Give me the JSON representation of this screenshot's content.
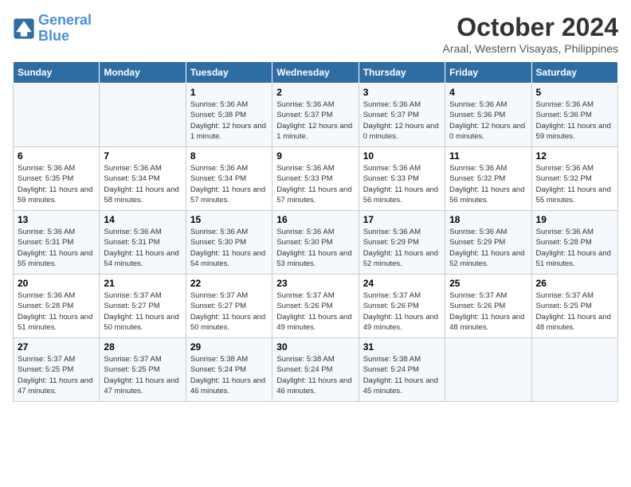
{
  "logo": {
    "line1": "General",
    "line2": "Blue"
  },
  "title": "October 2024",
  "subtitle": "Araal, Western Visayas, Philippines",
  "weekdays": [
    "Sunday",
    "Monday",
    "Tuesday",
    "Wednesday",
    "Thursday",
    "Friday",
    "Saturday"
  ],
  "weeks": [
    [
      {
        "day": "",
        "info": ""
      },
      {
        "day": "",
        "info": ""
      },
      {
        "day": "1",
        "info": "Sunrise: 5:36 AM\nSunset: 5:38 PM\nDaylight: 12 hours\nand 1 minute."
      },
      {
        "day": "2",
        "info": "Sunrise: 5:36 AM\nSunset: 5:37 PM\nDaylight: 12 hours\nand 1 minute."
      },
      {
        "day": "3",
        "info": "Sunrise: 5:36 AM\nSunset: 5:37 PM\nDaylight: 12 hours\nand 0 minutes."
      },
      {
        "day": "4",
        "info": "Sunrise: 5:36 AM\nSunset: 5:36 PM\nDaylight: 12 hours\nand 0 minutes."
      },
      {
        "day": "5",
        "info": "Sunrise: 5:36 AM\nSunset: 5:36 PM\nDaylight: 11 hours\nand 59 minutes."
      }
    ],
    [
      {
        "day": "6",
        "info": "Sunrise: 5:36 AM\nSunset: 5:35 PM\nDaylight: 11 hours\nand 59 minutes."
      },
      {
        "day": "7",
        "info": "Sunrise: 5:36 AM\nSunset: 5:34 PM\nDaylight: 11 hours\nand 58 minutes."
      },
      {
        "day": "8",
        "info": "Sunrise: 5:36 AM\nSunset: 5:34 PM\nDaylight: 11 hours\nand 57 minutes."
      },
      {
        "day": "9",
        "info": "Sunrise: 5:36 AM\nSunset: 5:33 PM\nDaylight: 11 hours\nand 57 minutes."
      },
      {
        "day": "10",
        "info": "Sunrise: 5:36 AM\nSunset: 5:33 PM\nDaylight: 11 hours\nand 56 minutes."
      },
      {
        "day": "11",
        "info": "Sunrise: 5:36 AM\nSunset: 5:32 PM\nDaylight: 11 hours\nand 56 minutes."
      },
      {
        "day": "12",
        "info": "Sunrise: 5:36 AM\nSunset: 5:32 PM\nDaylight: 11 hours\nand 55 minutes."
      }
    ],
    [
      {
        "day": "13",
        "info": "Sunrise: 5:36 AM\nSunset: 5:31 PM\nDaylight: 11 hours\nand 55 minutes."
      },
      {
        "day": "14",
        "info": "Sunrise: 5:36 AM\nSunset: 5:31 PM\nDaylight: 11 hours\nand 54 minutes."
      },
      {
        "day": "15",
        "info": "Sunrise: 5:36 AM\nSunset: 5:30 PM\nDaylight: 11 hours\nand 54 minutes."
      },
      {
        "day": "16",
        "info": "Sunrise: 5:36 AM\nSunset: 5:30 PM\nDaylight: 11 hours\nand 53 minutes."
      },
      {
        "day": "17",
        "info": "Sunrise: 5:36 AM\nSunset: 5:29 PM\nDaylight: 11 hours\nand 52 minutes."
      },
      {
        "day": "18",
        "info": "Sunrise: 5:36 AM\nSunset: 5:29 PM\nDaylight: 11 hours\nand 52 minutes."
      },
      {
        "day": "19",
        "info": "Sunrise: 5:36 AM\nSunset: 5:28 PM\nDaylight: 11 hours\nand 51 minutes."
      }
    ],
    [
      {
        "day": "20",
        "info": "Sunrise: 5:36 AM\nSunset: 5:28 PM\nDaylight: 11 hours\nand 51 minutes."
      },
      {
        "day": "21",
        "info": "Sunrise: 5:37 AM\nSunset: 5:27 PM\nDaylight: 11 hours\nand 50 minutes."
      },
      {
        "day": "22",
        "info": "Sunrise: 5:37 AM\nSunset: 5:27 PM\nDaylight: 11 hours\nand 50 minutes."
      },
      {
        "day": "23",
        "info": "Sunrise: 5:37 AM\nSunset: 5:26 PM\nDaylight: 11 hours\nand 49 minutes."
      },
      {
        "day": "24",
        "info": "Sunrise: 5:37 AM\nSunset: 5:26 PM\nDaylight: 11 hours\nand 49 minutes."
      },
      {
        "day": "25",
        "info": "Sunrise: 5:37 AM\nSunset: 5:26 PM\nDaylight: 11 hours\nand 48 minutes."
      },
      {
        "day": "26",
        "info": "Sunrise: 5:37 AM\nSunset: 5:25 PM\nDaylight: 11 hours\nand 48 minutes."
      }
    ],
    [
      {
        "day": "27",
        "info": "Sunrise: 5:37 AM\nSunset: 5:25 PM\nDaylight: 11 hours\nand 47 minutes."
      },
      {
        "day": "28",
        "info": "Sunrise: 5:37 AM\nSunset: 5:25 PM\nDaylight: 11 hours\nand 47 minutes."
      },
      {
        "day": "29",
        "info": "Sunrise: 5:38 AM\nSunset: 5:24 PM\nDaylight: 11 hours\nand 46 minutes."
      },
      {
        "day": "30",
        "info": "Sunrise: 5:38 AM\nSunset: 5:24 PM\nDaylight: 11 hours\nand 46 minutes."
      },
      {
        "day": "31",
        "info": "Sunrise: 5:38 AM\nSunset: 5:24 PM\nDaylight: 11 hours\nand 45 minutes."
      },
      {
        "day": "",
        "info": ""
      },
      {
        "day": "",
        "info": ""
      }
    ]
  ]
}
